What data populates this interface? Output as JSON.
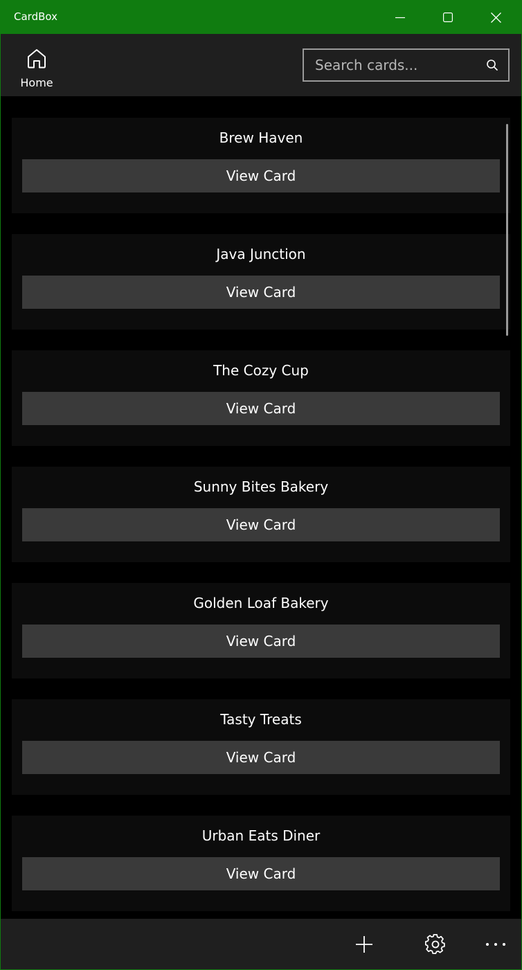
{
  "window": {
    "title": "CardBox",
    "accent_color": "#107c10"
  },
  "topbar": {
    "home_label": "Home",
    "search_placeholder": "Search cards..."
  },
  "cards": [
    {
      "name": "Brew Haven",
      "button_label": "View Card"
    },
    {
      "name": "Java Junction",
      "button_label": "View Card"
    },
    {
      "name": "The Cozy Cup",
      "button_label": "View Card"
    },
    {
      "name": "Sunny Bites Bakery",
      "button_label": "View Card"
    },
    {
      "name": "Golden Loaf Bakery",
      "button_label": "View Card"
    },
    {
      "name": "Tasty Treats",
      "button_label": "View Card"
    },
    {
      "name": "Urban Eats Diner",
      "button_label": "View Card"
    }
  ],
  "icons": {
    "minimize": "minimize-icon",
    "maximize": "maximize-icon",
    "close": "close-icon",
    "home": "home-icon",
    "search": "search-icon",
    "add": "add-icon",
    "settings": "gear-icon",
    "more": "more-icon"
  }
}
